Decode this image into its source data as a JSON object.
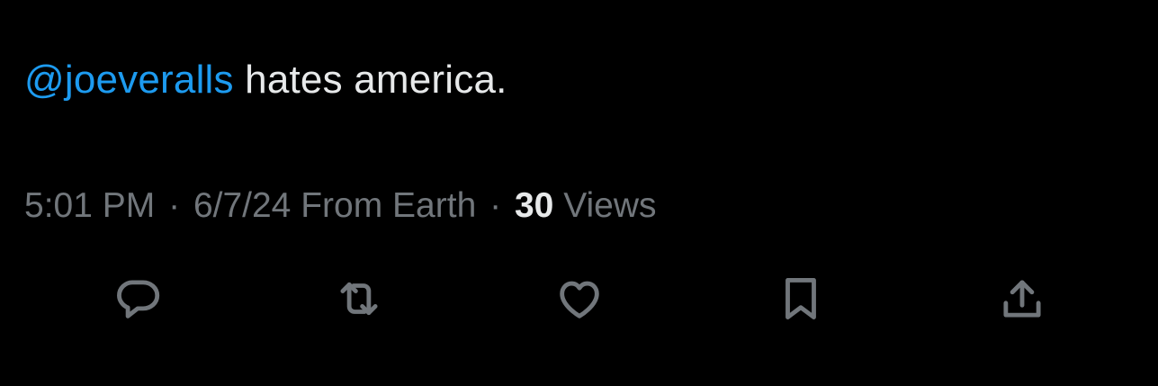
{
  "tweet": {
    "mention": "@joeveralls",
    "text": " hates america."
  },
  "meta": {
    "time": "5:01 PM",
    "separator": "·",
    "date": "6/7/24",
    "source": "From Earth",
    "views_count": "30",
    "views_label": "Views"
  },
  "actions": [
    {
      "name": "reply",
      "icon": "speech-bubble-icon"
    },
    {
      "name": "repost",
      "icon": "repost-arrows-icon"
    },
    {
      "name": "like",
      "icon": "heart-icon"
    },
    {
      "name": "bookmark",
      "icon": "bookmark-icon"
    },
    {
      "name": "share",
      "icon": "share-upload-icon"
    }
  ],
  "colors": {
    "background": "#000000",
    "mention": "#1d9bf0",
    "text": "#e7e9ea",
    "muted": "#71767b"
  }
}
